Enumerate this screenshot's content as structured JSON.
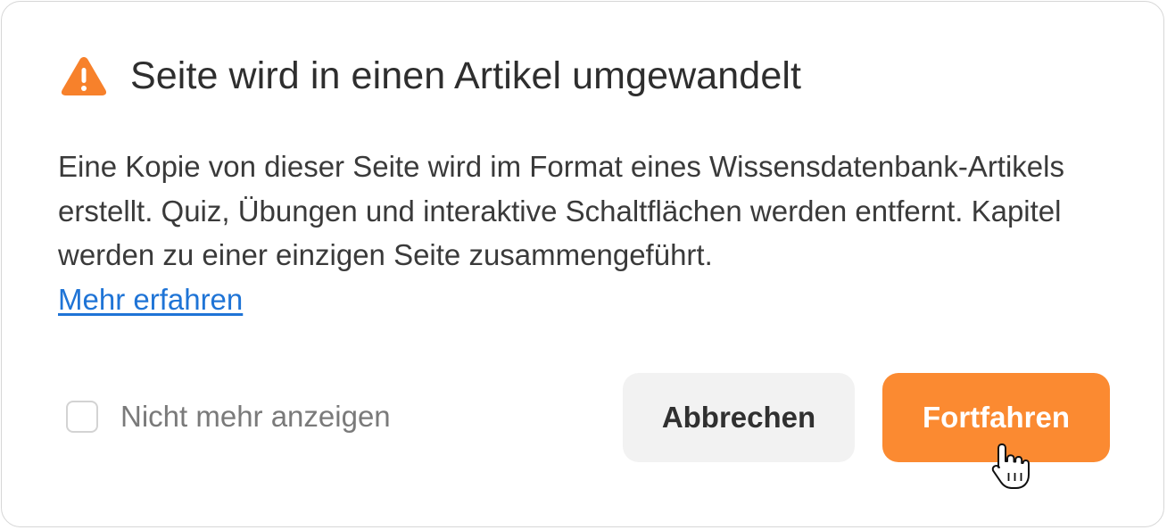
{
  "dialog": {
    "title": "Seite wird in einen Artikel umgewandelt",
    "icon": "warning-triangle-icon",
    "body_text": "Eine Kopie von dieser Seite wird im Format eines Wissensdatenbank-Artikels erstellt. Quiz, Übungen und interaktive Schaltflächen werden entfernt. Kapitel werden zu einer einzigen Seite zusammengeführt.",
    "learn_more_label": "Mehr erfahren",
    "checkbox": {
      "label": "Nicht mehr anzeigen",
      "checked": false
    },
    "buttons": {
      "cancel_label": "Abbrechen",
      "continue_label": "Fortfahren"
    }
  },
  "colors": {
    "accent": "#fb8a31",
    "link": "#1f74d6",
    "cancel_bg": "#f2f2f2",
    "title_text": "#2e2e2e"
  },
  "cursor": "hand-pointer-icon"
}
